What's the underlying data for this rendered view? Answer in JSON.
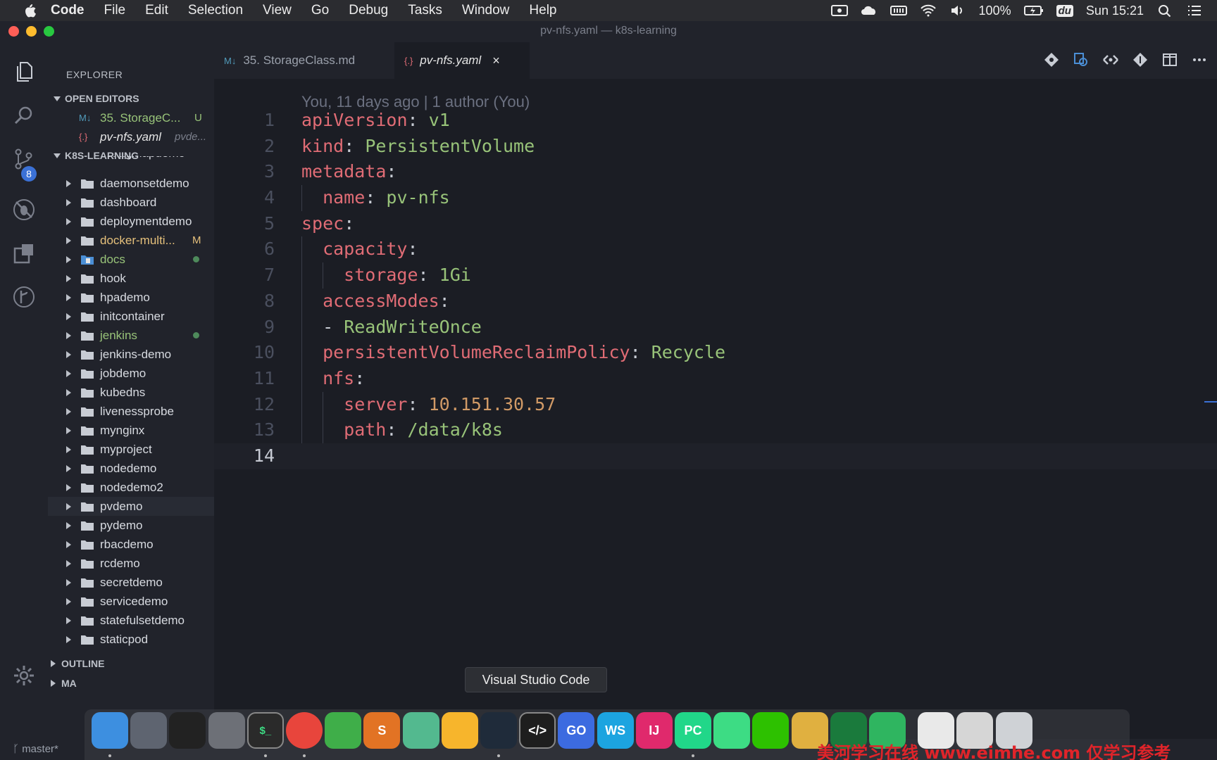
{
  "menubar": {
    "app": "Code",
    "items": [
      "File",
      "Edit",
      "Selection",
      "View",
      "Go",
      "Debug",
      "Tasks",
      "Window",
      "Help"
    ],
    "battery": "100%",
    "clock": "Sun 15:21",
    "du_label": "du"
  },
  "window": {
    "title": "pv-nfs.yaml — k8s-learning"
  },
  "activity": {
    "scm_badge": "8"
  },
  "sidebar": {
    "title": "EXPLORER",
    "open_editors_header": "OPEN EDITORS",
    "open_editors": [
      {
        "icon": "M↓",
        "name": "35. StorageC...",
        "status": "U",
        "color": "#98c379"
      },
      {
        "icon": "{.}",
        "name": "pv-nfs.yaml",
        "desc": "pvde...",
        "color": "#e6e6e6"
      }
    ],
    "project_header": "K8S-LEARNING",
    "partial_item": "configmapdemo",
    "tree": [
      {
        "label": "daemonsetdemo"
      },
      {
        "label": "dashboard"
      },
      {
        "label": "deploymentdemo"
      },
      {
        "label": "docker-multi...",
        "mark": "M",
        "color": "#e5c07b"
      },
      {
        "label": "docs",
        "dot": true,
        "color": "#98c379",
        "special": true
      },
      {
        "label": "hook"
      },
      {
        "label": "hpademo"
      },
      {
        "label": "initcontainer"
      },
      {
        "label": "jenkins",
        "dot": true,
        "color": "#98c379"
      },
      {
        "label": "jenkins-demo"
      },
      {
        "label": "jobdemo"
      },
      {
        "label": "kubedns"
      },
      {
        "label": "livenessprobe"
      },
      {
        "label": "mynginx"
      },
      {
        "label": "myproject"
      },
      {
        "label": "nodedemo"
      },
      {
        "label": "nodedemo2"
      },
      {
        "label": "pvdemo",
        "selected": true
      },
      {
        "label": "pydemo"
      },
      {
        "label": "rbacdemo"
      },
      {
        "label": "rcdemo"
      },
      {
        "label": "secretdemo"
      },
      {
        "label": "servicedemo"
      },
      {
        "label": "statefulsetdemo"
      },
      {
        "label": "staticpod"
      }
    ],
    "outline_header": "OUTLINE",
    "maven_header": "MA"
  },
  "tabs": [
    {
      "icon": "M↓",
      "label": "35. StorageClass.md",
      "active": false
    },
    {
      "icon": "{.}",
      "label": "pv-nfs.yaml",
      "active": true,
      "close": "×"
    }
  ],
  "editor": {
    "blame": "You, 11 days ago | 1 author (You)",
    "lines": [
      {
        "n": "1",
        "indent": 0,
        "key": "apiVersion",
        "value": "v1",
        "vtype": "s"
      },
      {
        "n": "2",
        "indent": 0,
        "key": "kind",
        "value": "PersistentVolume",
        "vtype": "s"
      },
      {
        "n": "3",
        "indent": 0,
        "key": "metadata",
        "value": "",
        "vtype": "s"
      },
      {
        "n": "4",
        "indent": 1,
        "key": "name",
        "value": "pv-nfs",
        "vtype": "s"
      },
      {
        "n": "5",
        "indent": 0,
        "key": "spec",
        "value": "",
        "vtype": "s"
      },
      {
        "n": "6",
        "indent": 1,
        "key": "capacity",
        "value": "",
        "vtype": "s"
      },
      {
        "n": "7",
        "indent": 2,
        "key": "storage",
        "value": "1Gi",
        "vtype": "s"
      },
      {
        "n": "8",
        "indent": 1,
        "key": "accessModes",
        "value": "",
        "vtype": "s"
      },
      {
        "n": "9",
        "indent": 1,
        "dash": true,
        "value": "ReadWriteOnce",
        "vtype": "s"
      },
      {
        "n": "10",
        "indent": 1,
        "key": "persistentVolumeReclaimPolicy",
        "value": "Recycle",
        "vtype": "s"
      },
      {
        "n": "11",
        "indent": 1,
        "key": "nfs",
        "value": "",
        "vtype": "s"
      },
      {
        "n": "12",
        "indent": 2,
        "key": "server",
        "value": "10.151.30.57",
        "vtype": "n"
      },
      {
        "n": "13",
        "indent": 2,
        "key": "path",
        "value": "/data/k8s",
        "vtype": "s"
      },
      {
        "n": "14",
        "indent": 0,
        "empty": true,
        "current": true
      }
    ]
  },
  "tooltip": "Visual Studio Code",
  "statusbar": {
    "branch": "master*"
  },
  "dock": {
    "items": [
      {
        "name": "finder",
        "color": "#3d8fe0",
        "text": ""
      },
      {
        "name": "launchpad",
        "color": "#5e6470",
        "text": ""
      },
      {
        "name": "qq",
        "color": "#222222",
        "text": ""
      },
      {
        "name": "system-preferences",
        "color": "#6d7077",
        "text": ""
      },
      {
        "name": "terminal",
        "color": "#2a2a2a",
        "text": "$_"
      },
      {
        "name": "chrome",
        "color": "#e8453c",
        "text": ""
      },
      {
        "name": "evernote",
        "color": "#3fae49",
        "text": ""
      },
      {
        "name": "sublime",
        "color": "#e27324",
        "text": "S"
      },
      {
        "name": "atom",
        "color": "#53b98f",
        "text": ""
      },
      {
        "name": "sketch",
        "color": "#f7b52c",
        "text": ""
      },
      {
        "name": "vscode",
        "color": "#1f2b3a",
        "text": ""
      },
      {
        "name": "code-editor",
        "color": "#1e1e1e",
        "text": "</>"
      },
      {
        "name": "goland",
        "color": "#3c6be0",
        "text": "GO"
      },
      {
        "name": "webstorm",
        "color": "#1ca4e0",
        "text": "WS"
      },
      {
        "name": "intellij",
        "color": "#e0296c",
        "text": "IJ"
      },
      {
        "name": "pycharm",
        "color": "#21d789",
        "text": "PC"
      },
      {
        "name": "android-studio",
        "color": "#3ddc84",
        "text": ""
      },
      {
        "name": "wechat",
        "color": "#2dc100",
        "text": ""
      },
      {
        "name": "bird-app",
        "color": "#e0b040",
        "text": ""
      },
      {
        "name": "iterm",
        "color": "#1a7a3c",
        "text": ""
      },
      {
        "name": "chat-app",
        "color": "#2fb560",
        "text": ""
      },
      {
        "name": "swift-file",
        "color": "#e9e9e9",
        "text": ""
      },
      {
        "name": "file",
        "color": "#d6d6d6",
        "text": ""
      },
      {
        "name": "trash",
        "color": "#cfd2d6",
        "text": ""
      }
    ]
  },
  "watermark": "美河学习在线 www.eimhe.com 仅学习参考"
}
